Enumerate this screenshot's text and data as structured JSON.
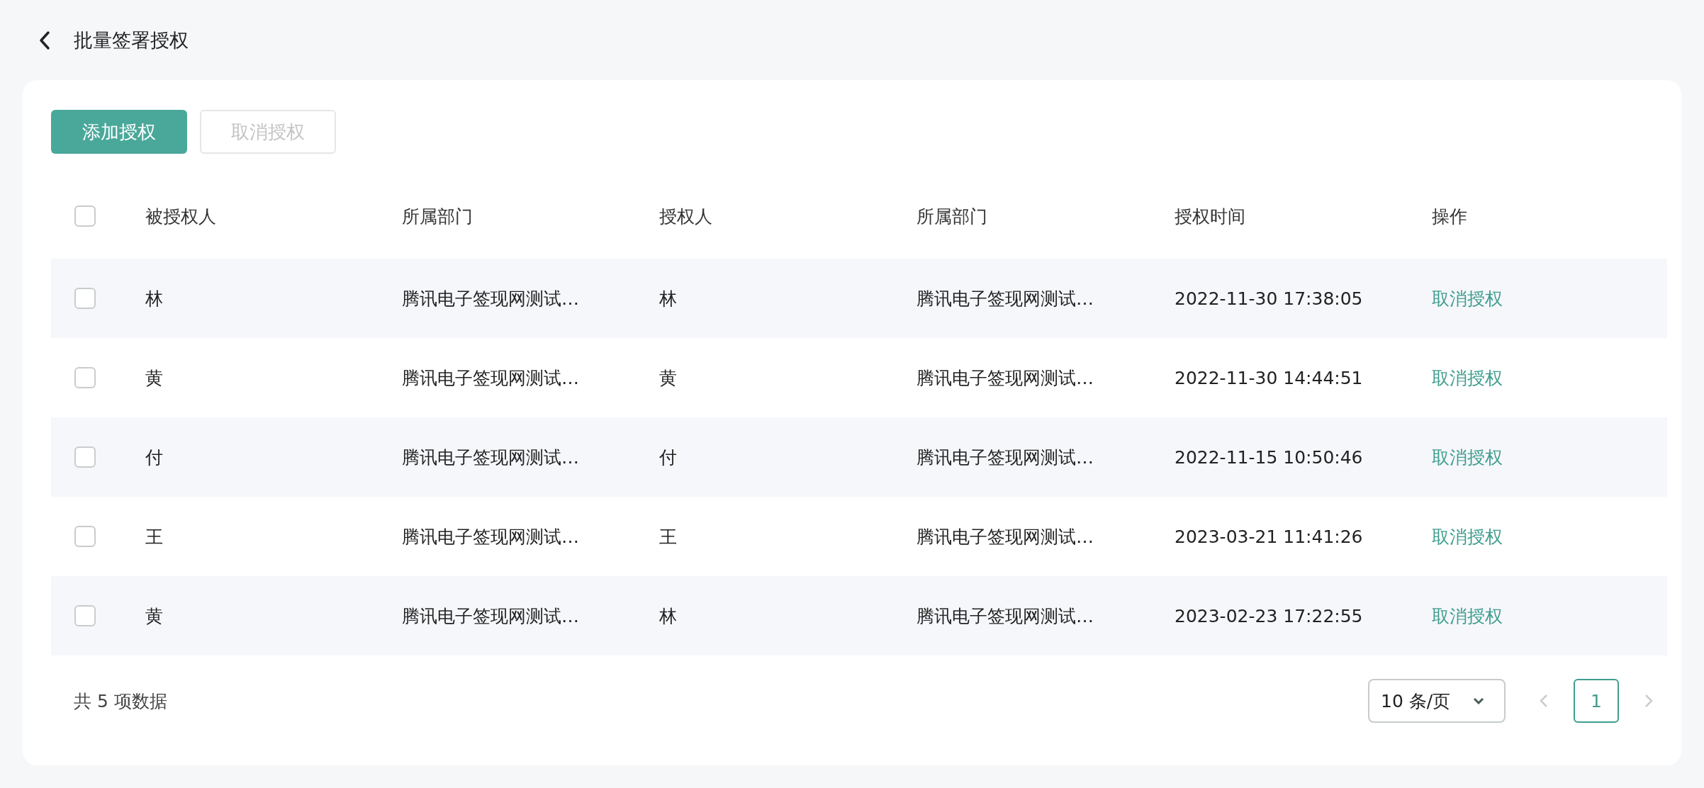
{
  "page": {
    "title": "批量签署授权"
  },
  "toolbar": [
    {
      "label": "添加授权",
      "disabled": false
    },
    {
      "label": "取消授权",
      "disabled": true
    }
  ],
  "table": {
    "select_all": {
      "checked": false
    },
    "columns": [
      "被授权人",
      "所属部门",
      "授权人",
      "所属部门",
      "授权时间",
      "操作"
    ],
    "rows": [
      {
        "checked": false,
        "grantee": "林",
        "grantee_dept": "腾讯电子签现网测试…",
        "grantor": "林",
        "grantor_dept": "腾讯电子签现网测试…",
        "time": "2022-11-30 17:38:05",
        "action": "取消授权"
      },
      {
        "checked": false,
        "grantee": "黄",
        "grantee_dept": "腾讯电子签现网测试…",
        "grantor": "黄",
        "grantor_dept": "腾讯电子签现网测试…",
        "time": "2022-11-30 14:44:51",
        "action": "取消授权"
      },
      {
        "checked": false,
        "grantee": "付",
        "grantee_dept": "腾讯电子签现网测试…",
        "grantor": "付",
        "grantor_dept": "腾讯电子签现网测试…",
        "time": "2022-11-15 10:50:46",
        "action": "取消授权"
      },
      {
        "checked": false,
        "grantee": "王",
        "grantee_dept": "腾讯电子签现网测试…",
        "grantor": "王",
        "grantor_dept": "腾讯电子签现网测试…",
        "time": "2023-03-21 11:41:26",
        "action": "取消授权"
      },
      {
        "checked": false,
        "grantee": "黄",
        "grantee_dept": "腾讯电子签现网测试…",
        "grantor": "林",
        "grantor_dept": "腾讯电子签现网测试…",
        "time": "2023-02-23 17:22:55",
        "action": "取消授权"
      }
    ]
  },
  "footer": {
    "total": "共 5 项数据",
    "page_size": "10 条/页",
    "pages": [
      {
        "label": "1",
        "selected": true
      }
    ]
  }
}
